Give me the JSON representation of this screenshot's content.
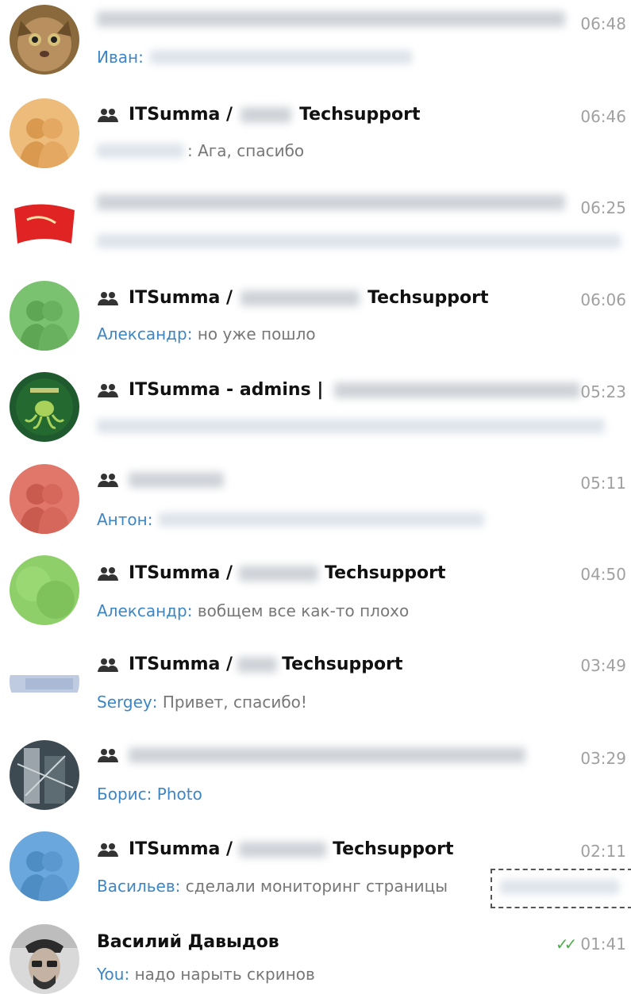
{
  "chats": [
    {
      "avatar": "cat-photo-avatar",
      "is_group": false,
      "title": "",
      "title_suffix": "",
      "time": "06:48",
      "sender": "Иван",
      "message": ""
    },
    {
      "avatar": "group-placeholder-avatar",
      "is_group": true,
      "title": "ITSumma /",
      "title_suffix": "Techsupport",
      "time": "06:46",
      "sender": "",
      "message": "Ага, спасибо"
    },
    {
      "avatar": "red-flag-avatar",
      "is_group": false,
      "title": "",
      "title_suffix": "",
      "time": "06:25",
      "sender": "",
      "message": ""
    },
    {
      "avatar": "group-placeholder-avatar",
      "is_group": true,
      "title": "ITSumma /",
      "title_suffix": "Techsupport",
      "time": "06:06",
      "sender": "Александр",
      "message": "но уже пошло"
    },
    {
      "avatar": "octopus-avatar",
      "is_group": true,
      "title": "ITSumma - admins |",
      "title_suffix": "",
      "time": "05:23",
      "sender": "",
      "message": ""
    },
    {
      "avatar": "group-placeholder-avatar",
      "is_group": true,
      "title": "",
      "title_suffix": "",
      "time": "05:11",
      "sender": "Антон",
      "message": ""
    },
    {
      "avatar": "green-blurred-avatar",
      "is_group": true,
      "title": "ITSumma /",
      "title_suffix": "Techsupport",
      "time": "04:50",
      "sender": "Александр",
      "message": "вобщем все как-то плохо"
    },
    {
      "avatar": "blue-blurred-avatar",
      "is_group": true,
      "title": "ITSumma /",
      "title_suffix": "Techsupport",
      "time": "03:49",
      "sender": "Sergey",
      "message": "Привет, спасибо!"
    },
    {
      "avatar": "drawing-photo-avatar",
      "is_group": true,
      "title": "",
      "title_suffix": "",
      "time": "03:29",
      "sender": "Борис",
      "message": "Photo"
    },
    {
      "avatar": "group-placeholder-avatar",
      "is_group": true,
      "title": "ITSumma /",
      "title_suffix": "Techsupport",
      "time": "02:11",
      "sender": "Васильев",
      "message": "сделали мониторинг страницы"
    },
    {
      "avatar": "man-photo-avatar",
      "is_group": false,
      "title": "Василий Давыдов",
      "title_suffix": "",
      "time": "01:41",
      "sender": "You",
      "message": "надо нарыть скринов",
      "read_check": true
    }
  ],
  "colors": {
    "sender_blue": "#3d86c6",
    "time_gray": "#a0a0a0",
    "preview_gray": "#777777",
    "read_check_green": "#4fae4e",
    "placeholder_yellow": "#edbb7a",
    "placeholder_green": "#7ac170",
    "placeholder_red": "#e1776b",
    "placeholder_blue": "#6aa7dc"
  }
}
